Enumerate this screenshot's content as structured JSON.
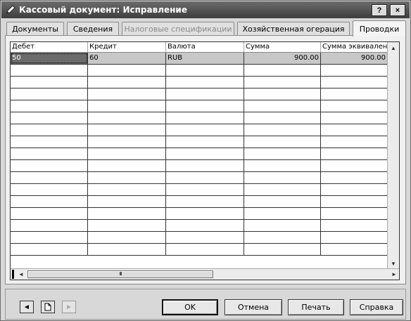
{
  "window": {
    "title": "Кассовый документ: Исправление",
    "help_label": "?",
    "close_label": "×"
  },
  "tabs": [
    {
      "label": "Документы",
      "state": "normal"
    },
    {
      "label": "Сведения",
      "state": "normal"
    },
    {
      "label": "Налоговые спецификации",
      "state": "disabled"
    },
    {
      "label": "Хозяйственная огерация",
      "state": "normal"
    },
    {
      "label": "Проводки",
      "state": "active"
    }
  ],
  "grid": {
    "columns": [
      "Дебет",
      "Кредит",
      "Валюта",
      "Сумма",
      "Сумма эквивалент"
    ],
    "rows": [
      [
        "50",
        "60",
        "RUB",
        "900.00",
        "900.00"
      ]
    ],
    "empty_rows": 16
  },
  "scrollbar": {
    "up": "▲",
    "down": "▼",
    "left": "◄",
    "right": "►",
    "thumb_grip": "III"
  },
  "bottom": {
    "prev": "◄",
    "new_doc": "",
    "next": "►",
    "ok": "OK",
    "cancel": "Отмена",
    "print": "Печать",
    "help": "Справка"
  }
}
